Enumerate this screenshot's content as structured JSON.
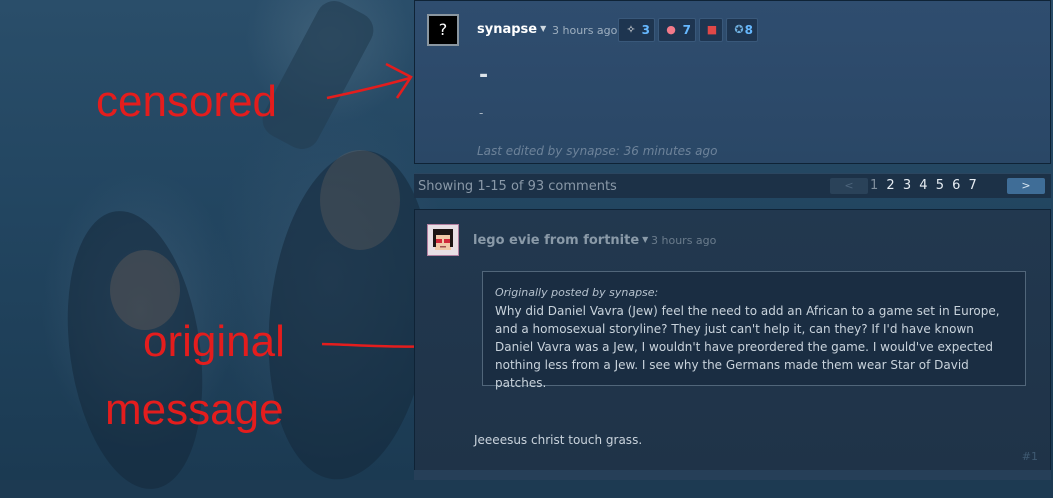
{
  "annotations": {
    "censored": "censored",
    "original": "original",
    "message": "message"
  },
  "comments": [
    {
      "avatar": "?",
      "author": "synapse",
      "time": "3 hours ago",
      "awards": [
        {
          "icon": "winged-award-icon",
          "count": "3"
        },
        {
          "icon": "pill-award-icon",
          "count": "7"
        },
        {
          "icon": "gift-award-icon",
          "count": ""
        },
        {
          "icon": "ribbon-award-icon",
          "count": "8"
        }
      ],
      "body_title": "-",
      "body_text": "-",
      "edited_prefix": "Last edited by",
      "edited_by": "synapse",
      "edited_suffix": ": 36 minutes ago"
    },
    {
      "avatar": "lego-evie-avatar",
      "author": "lego evie from fortnite",
      "time": "3 hours ago",
      "quote": {
        "prefix": "Originally posted by",
        "author": "synapse",
        "suffix": ":",
        "text": "Why did Daniel Vavra (Jew) feel the need to add an African to a game set in Europe, and a homosexual storyline? They just can't help it, can they? If I'd have known Daniel Vavra was a Jew, I wouldn't have preordered the game. I would've expected nothing less from a Jew. I see why the Germans made them wear Star of David patches."
      },
      "reply": "Jeeeesus christ touch grass.",
      "number": "#1"
    }
  ],
  "paging": {
    "summary": "Showing 1-15 of 93 comments",
    "prev": "<",
    "next": ">",
    "pages": [
      "1",
      "2",
      "3",
      "4",
      "5",
      "6",
      "7"
    ],
    "current": "1"
  },
  "colors": {
    "annotation": "#e41d1d",
    "award_count": "#66b8ff",
    "next_button": "#3f6d97"
  }
}
